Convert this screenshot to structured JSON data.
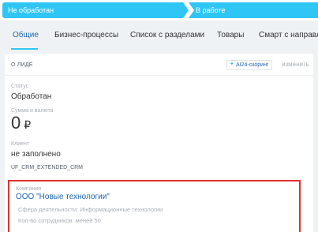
{
  "stages": [
    {
      "label": "Не обработан"
    },
    {
      "label": "В работе"
    }
  ],
  "tabs": [
    {
      "label": "Общие",
      "active": true
    },
    {
      "label": "Бизнес-процессы"
    },
    {
      "label": "Список с разделами"
    },
    {
      "label": "Товары"
    },
    {
      "label": "Смарт с направле"
    }
  ],
  "card": {
    "title": "О ЛИДЕ",
    "ai_badge": "AI24-скоринг",
    "edit": "изменить",
    "status": {
      "label": "Статус",
      "value": "Обработан"
    },
    "sum": {
      "label": "Сумма и валюта",
      "amount": "0",
      "currency": "₽"
    },
    "client": {
      "label": "Клиент",
      "value": "не заполнено"
    },
    "uf_field": "UF_CRM_EXTENDED_CRM",
    "company": {
      "label": "Компания",
      "name": "ООО \"Новые технологии\"",
      "details": [
        "Сфера деятельности: Информационные технологии",
        "Кол-во сотрудников: менее 50"
      ]
    }
  },
  "colors": {
    "stage": "#2fc6f6",
    "link": "#2067b0",
    "highlight": "#e03030",
    "background": "#eef2f4"
  }
}
